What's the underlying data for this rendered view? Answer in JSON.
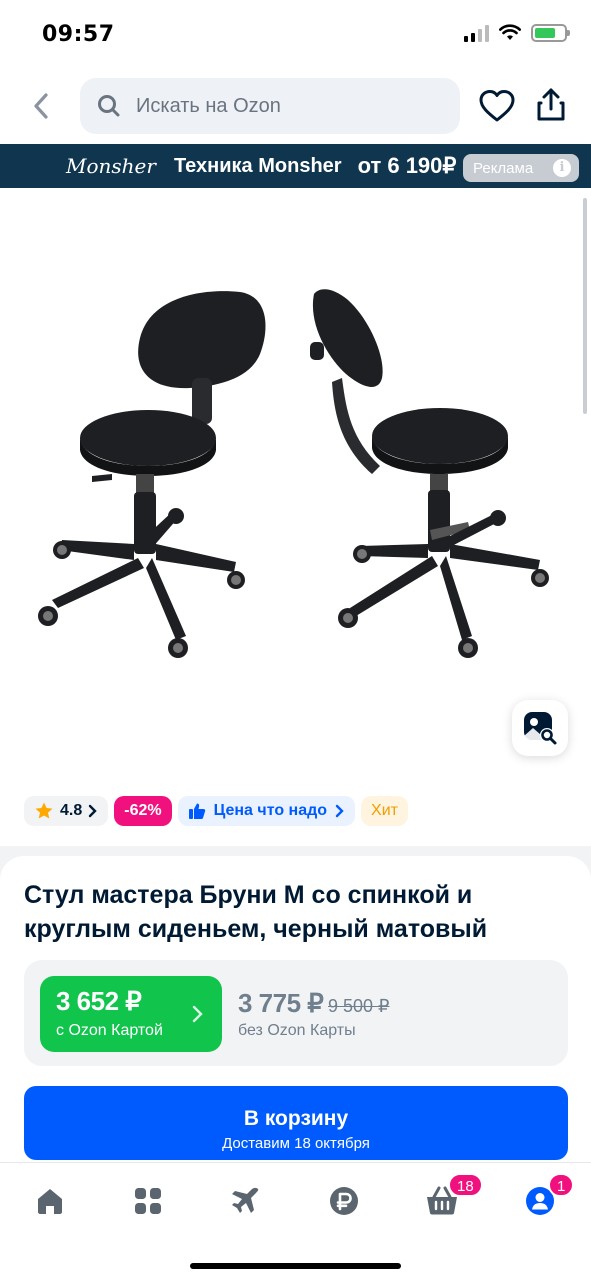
{
  "status_bar": {
    "time": "09:57"
  },
  "search": {
    "placeholder": "Искать на Ozon"
  },
  "ad_banner": {
    "brand": "Monsher",
    "title": "Техника Monsher",
    "price": "от 6 190₽",
    "tag": "Реклама"
  },
  "badges": {
    "rating": "4.8",
    "discount": "-62%",
    "promo": "Цена что надо",
    "hit": "Хит"
  },
  "product": {
    "title": "Стул мастера Бруни М со спинкой и круглым сиденьем, черный матовый"
  },
  "price": {
    "ozon_card_price": "3 652 ₽",
    "ozon_card_label": "с Ozon Картой",
    "regular_price": "3 775 ₽",
    "old_price": "9 500 ₽",
    "regular_label": "без Ozon Карты"
  },
  "cart_button": {
    "label": "В корзину",
    "delivery": "Доставим 18 октября"
  },
  "nav": {
    "cart_count": "18",
    "profile_count": "1"
  },
  "colors": {
    "ozon_blue": "#005bff",
    "ozon_green": "#10c44c",
    "discount_pink": "#f1117e",
    "ad_bg": "#10354e"
  }
}
